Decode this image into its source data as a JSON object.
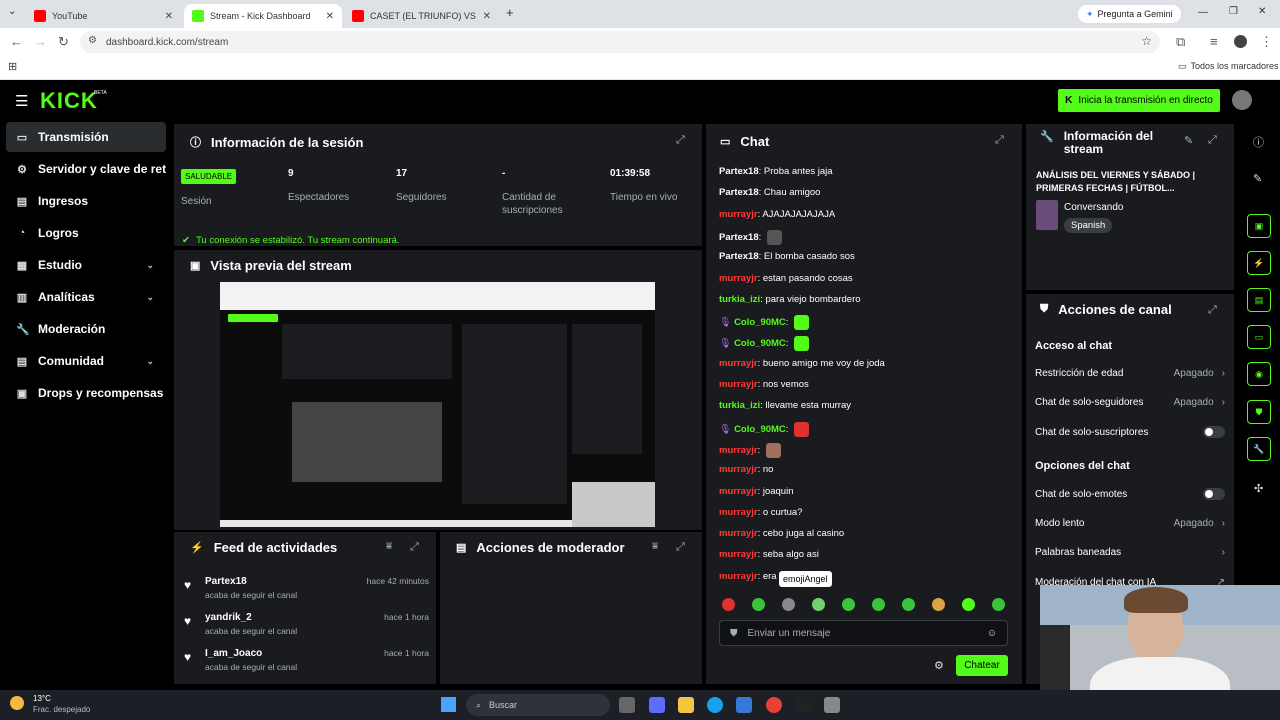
{
  "browser": {
    "tabs": [
      {
        "label": "YouTube",
        "color": "#ff0000"
      },
      {
        "label": "Stream - Kick Dashboard",
        "color": "#53fc18"
      },
      {
        "label": "CASET (EL TRIUNFO) VS SAN M",
        "color": "#ff0000"
      }
    ],
    "new_tab": "+",
    "gemini": "Pregunta a Gemini",
    "url": "dashboard.kick.com/stream",
    "bookmarks": "Todos los marcadores"
  },
  "header": {
    "logo": "KICK",
    "beta": "BETA",
    "go_live": "Inicia la transmisión en directo"
  },
  "sidebar": {
    "items": [
      {
        "label": "Transmisión",
        "icon": "▭"
      },
      {
        "label": "Servidor y clave de retransmisión",
        "icon": "⚙"
      },
      {
        "label": "Ingresos",
        "icon": "▤"
      },
      {
        "label": "Logros",
        "icon": "◔"
      },
      {
        "label": "Estudio",
        "icon": "▦",
        "chev": "⌄"
      },
      {
        "label": "Analíticas",
        "icon": "▥",
        "chev": "⌄"
      },
      {
        "label": "Moderación",
        "icon": "🔧"
      },
      {
        "label": "Comunidad",
        "icon": "▤",
        "chev": "⌄"
      },
      {
        "label": "Drops y recompensas",
        "icon": "▣"
      }
    ]
  },
  "session": {
    "title": "Información de la sesión",
    "badge": "SALUDABLE",
    "badge_label": "Sesión",
    "stats": [
      {
        "value": "9",
        "label": "Espectadores"
      },
      {
        "value": "17",
        "label": "Seguidores"
      },
      {
        "value": "-",
        "label": "Cantidad de suscripciones"
      },
      {
        "value": "01:39:58",
        "label": "Tiempo en vivo"
      }
    ],
    "notice": "Tu conexión se estabilizó. Tu stream continuará."
  },
  "preview": {
    "title": "Vista previa del stream"
  },
  "activity": {
    "title": "Feed de actividades",
    "items": [
      {
        "user": "Partex18",
        "action": "acaba de seguir el canal",
        "time": "hace 42 minutos"
      },
      {
        "user": "yandrik_2",
        "action": "acaba de seguir el canal",
        "time": "hace 1 hora"
      },
      {
        "user": "I_am_Joaco",
        "action": "acaba de seguir el canal",
        "time": "hace 1 hora"
      }
    ]
  },
  "mod_actions": {
    "title": "Acciones de moderador"
  },
  "chat": {
    "title": "Chat",
    "messages": [
      {
        "user": "Partex18",
        "cls": "u-g",
        "text": "Proba antes jaja"
      },
      {
        "user": "Partex18",
        "cls": "u-g",
        "text": "Chau amigoo"
      },
      {
        "user": "murrayjr",
        "cls": "u-r",
        "text": "AJAJAJAJAJAJA"
      },
      {
        "user": "Partex18",
        "cls": "u-g",
        "text": "",
        "emote": "#555"
      },
      {
        "user": "Partex18",
        "cls": "u-g",
        "text": "El bomba casado sos"
      },
      {
        "user": "murrayjr",
        "cls": "u-r",
        "text": "estan pasando cosas"
      },
      {
        "user": "turkia_izi",
        "cls": "u-l",
        "text": "para viejo bombardero"
      },
      {
        "user": "Colo_90MC",
        "cls": "u-l",
        "text": "",
        "emote": "#53fc18",
        "badge": "🎙"
      },
      {
        "user": "Colo_90MC",
        "cls": "u-l",
        "text": "",
        "emote": "#53fc18",
        "badge": "🎙"
      },
      {
        "user": "murrayjr",
        "cls": "u-r",
        "text": "bueno amigo me voy de joda"
      },
      {
        "user": "murrayjr",
        "cls": "u-r",
        "text": "nos vemos"
      },
      {
        "user": "turkia_izi",
        "cls": "u-l",
        "text": "llevame esta murray"
      },
      {
        "user": "Colo_90MC",
        "cls": "u-l",
        "text": "",
        "emote": "#e03030",
        "badge": "🎙"
      },
      {
        "user": "murrayjr",
        "cls": "u-r",
        "text": "",
        "emote": "#a0705a"
      },
      {
        "user": "murrayjr",
        "cls": "u-r",
        "text": "no"
      },
      {
        "user": "murrayjr",
        "cls": "u-r",
        "text": "joaquin"
      },
      {
        "user": "murrayjr",
        "cls": "u-r",
        "text": "o curtua?"
      },
      {
        "user": "murrayjr",
        "cls": "u-r",
        "text": "cebo juga al casino"
      },
      {
        "user": "murrayjr",
        "cls": "u-r",
        "text": "seba algo asi"
      },
      {
        "user": "murrayjr",
        "cls": "u-r",
        "text": "era"
      }
    ],
    "tooltip": "emojiAngel",
    "emotes": [
      "#e03030",
      "#3bc43b",
      "#888",
      "#6fd36f",
      "#3bc43b",
      "#3bc43b",
      "#3bc43b",
      "#d9a441",
      "#53fc18",
      "#3bc43b"
    ],
    "input_placeholder": "Enviar un mensaje",
    "send": "Chatear"
  },
  "stream_info": {
    "title": "Información del stream",
    "stream_title": "ANÁLISIS DEL VIERNES Y SÁBADO | PRIMERAS FECHAS | FÚTBOL...",
    "category": "Conversando",
    "language": "Spanish"
  },
  "channel": {
    "title": "Acciones de canal",
    "access_heading": "Acceso al chat",
    "access": [
      {
        "label": "Restricción de edad",
        "value": "Apagado",
        "type": "chev"
      },
      {
        "label": "Chat de solo-seguidores",
        "value": "Apagado",
        "type": "chev"
      },
      {
        "label": "Chat de solo-suscriptores",
        "value": "",
        "type": "toggle"
      }
    ],
    "options_heading": "Opciones del chat",
    "options": [
      {
        "label": "Chat de solo-emotes",
        "value": "",
        "type": "toggle"
      },
      {
        "label": "Modo lento",
        "value": "Apagado",
        "type": "chev"
      },
      {
        "label": "Palabras baneadas",
        "value": "",
        "type": "chev"
      },
      {
        "label": "Moderación del chat con IA",
        "value": "",
        "type": "ext"
      }
    ]
  },
  "taskbar": {
    "weather_temp": "13°C",
    "weather_desc": "Frac. despejado",
    "search": "Buscar"
  },
  "colors": {
    "accent": "#53fc18",
    "panel": "#191b1f"
  }
}
